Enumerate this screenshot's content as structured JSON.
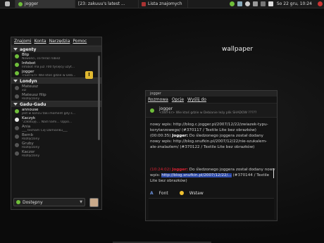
{
  "panel": {
    "apps_icon": "gnome-foot-icon",
    "task1": "jogger",
    "task2": "[23: zakuuu's latest ...",
    "task3": "Lista znajomych",
    "clock": "So 22 gru, 10:24"
  },
  "wallpaper": {
    "label": "wallpaper"
  },
  "roster": {
    "menu": [
      "Znajomi",
      "Konta",
      "Narzędzia",
      "Pomoc"
    ],
    "groups": [
      {
        "name": "agenty",
        "contacts": [
          {
            "name": "Blip",
            "status": "Nowości, co teraz robisz",
            "state": "online"
          },
          {
            "name": "Infobot",
            "status": "Infobot ma już 700 tysięcy użyt...",
            "state": "online"
          },
          {
            "name": "jogger",
            "status": "<Sxlr-Er> Wie ktoś gdzie w Deb...",
            "state": "online"
          }
        ]
      },
      {
        "name": "Londyn",
        "contacts": [
          {
            "name": "Mateusz",
            "status": "xD",
            "state": "offline"
          },
          {
            "name": "Mateusz filip",
            "status": "Rozłączony",
            "state": "offline"
          }
        ]
      },
      {
        "name": "Gadu-Gadu",
        "contacts": [
          {
            "name": "annouse",
            "status": "jest w końcu taki moment gdy s...",
            "state": "online"
          },
          {
            "name": "Kaczyk",
            "status": "\"Załatuję.... Nad nami... Uppo...",
            "state": "away"
          },
          {
            "name": "Ania",
            "status": "___ techam Cię Damianku___",
            "state": "offline"
          },
          {
            "name": "Bemb",
            "status": "Rozłączony",
            "state": "offline"
          },
          {
            "name": "Gruby",
            "status": "Rozłączony",
            "state": "offline"
          },
          {
            "name": "Kaczor",
            "status": "Rozłączony",
            "state": "offline"
          }
        ]
      }
    ],
    "status_select": "Dostępny",
    "notification_badge": "!"
  },
  "chat": {
    "title": "jogger",
    "menu": [
      "Rozmowa",
      "Opcje",
      "Wyślij do"
    ],
    "contact_name": "jogger",
    "contact_status": "<Sxlr-Er> Wie ktoś gdzie w Debianie leży plik SHADOW ?????",
    "log": [
      {
        "text": "nowy wpis: http://blog.c.jogger.pl/2007/12/22/zwiazek-typu-korytarzowego/ (#370117 / Textile Lite bez obrazków)"
      },
      {
        "time": "(00:00:35)",
        "nick": "Jogger:",
        "text": " Do śledzonego joggera został dodany nowy wpis: http://blog.snufkin.pl/2007/12/22/nie-szukalem-ale-znalazlem/ (#370122 / Textile Lite bez obrazków)"
      }
    ],
    "compose": {
      "time": "(10:24:02)",
      "nick": "Jogger:",
      "text": " Do śledzonego joggera został dodany nowy wpis:",
      "selected": "http://blog.snufkin.pl/2007/12/22/...",
      "tail": " (#370144 / Textile Lite bez obrazków)"
    },
    "toolbar": {
      "font": "Font",
      "insert": "Wstaw"
    }
  },
  "colors": {
    "online": "#6fbe3a",
    "offline": "#555555",
    "away": "#e8e8e8",
    "accent": "#2b48a8"
  }
}
